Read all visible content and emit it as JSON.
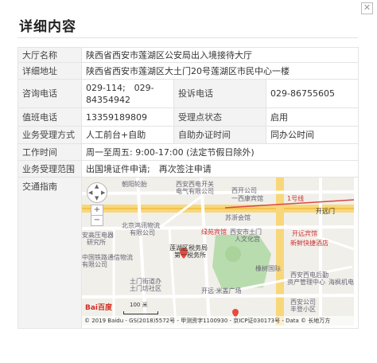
{
  "dialog": {
    "title": "详细内容",
    "close": "✕"
  },
  "rows": {
    "hall_name": {
      "label": "大厅名称",
      "value": "陕西省西安市莲湖区公安局出入境接待大厅"
    },
    "address": {
      "label": "详细地址",
      "value": "陕西省西安市莲湖区大土门20号莲湖区市民中心一楼"
    },
    "consult": {
      "label": "咨询电话",
      "value": "029-114; 029-84354942",
      "value_line1": "029-114;　029-",
      "value_line2": "84354942"
    },
    "complaint": {
      "label": "投诉电话",
      "value": "029-86755605"
    },
    "duty": {
      "label": "值班电话",
      "value": "13359189809"
    },
    "status": {
      "label": "受理点状态",
      "value": "启用"
    },
    "method": {
      "label": "业务受理方式",
      "value": "人工前台+自助"
    },
    "self_service_time": {
      "label": "自助办证时间",
      "value": "同办公时间"
    },
    "work_time": {
      "label": "工作时间",
      "value": "周一至周五: 9:00-17:00 (法定节假日除外)"
    },
    "scope": {
      "label": "业务受理范围",
      "value": "出国境证件申请;　再次签注申请"
    },
    "traffic": {
      "label": "交通指南"
    }
  },
  "map": {
    "labels": {
      "chaoyang_lunpan": "朝阳轮胎",
      "xian_dianqi": "西安西电开关",
      "dianqi": "电气有限公司",
      "xisu": "西开公司",
      "xisu2": "一西康宾馆",
      "subway_mark": "1号线",
      "kaiyuanmen": "开远门",
      "sujihui": "苏浙会馆",
      "beijing_wuliu": "北京鸿讯物流",
      "wuliu2": "有限公司",
      "luyuan": "绿苑宾馆",
      "xian_tumen": "西安市土门",
      "tumen2": "人文化宫",
      "kaiyuan_hotel": "开远宾馆",
      "anjiu": "安高压电器",
      "yanjiusuo": "研究所",
      "lianhu_tax": "莲湖区税务局",
      "tax2": "第一税务所",
      "xinxian": "新鲜快捷酒店",
      "zhongguo": "中国铁路通信物流",
      "youxian": "有限公司",
      "tumen_street": "土门街道办",
      "tumen_fang": "土门坊社区",
      "xinfu": "橡树国际",
      "shiyu": "西安西电后勤",
      "shiyu2": "资产管理中心",
      "kaiyuan_mi": "开远·米盖广场",
      "xiya": "西安公司",
      "xiya2": "丰登小区",
      "haiyang": "海枫机电",
      "tumen_bianlidian": "土门坊社区"
    },
    "scale": "100 米",
    "baidu_logo": "Bai百度",
    "copyright": "© 2019 Baidu - GS(2018)5572号 - 甲测资字1100930 - 京ICP证030173号 - Data © 长地万方",
    "zoom_in": "+",
    "zoom_out": "−"
  }
}
